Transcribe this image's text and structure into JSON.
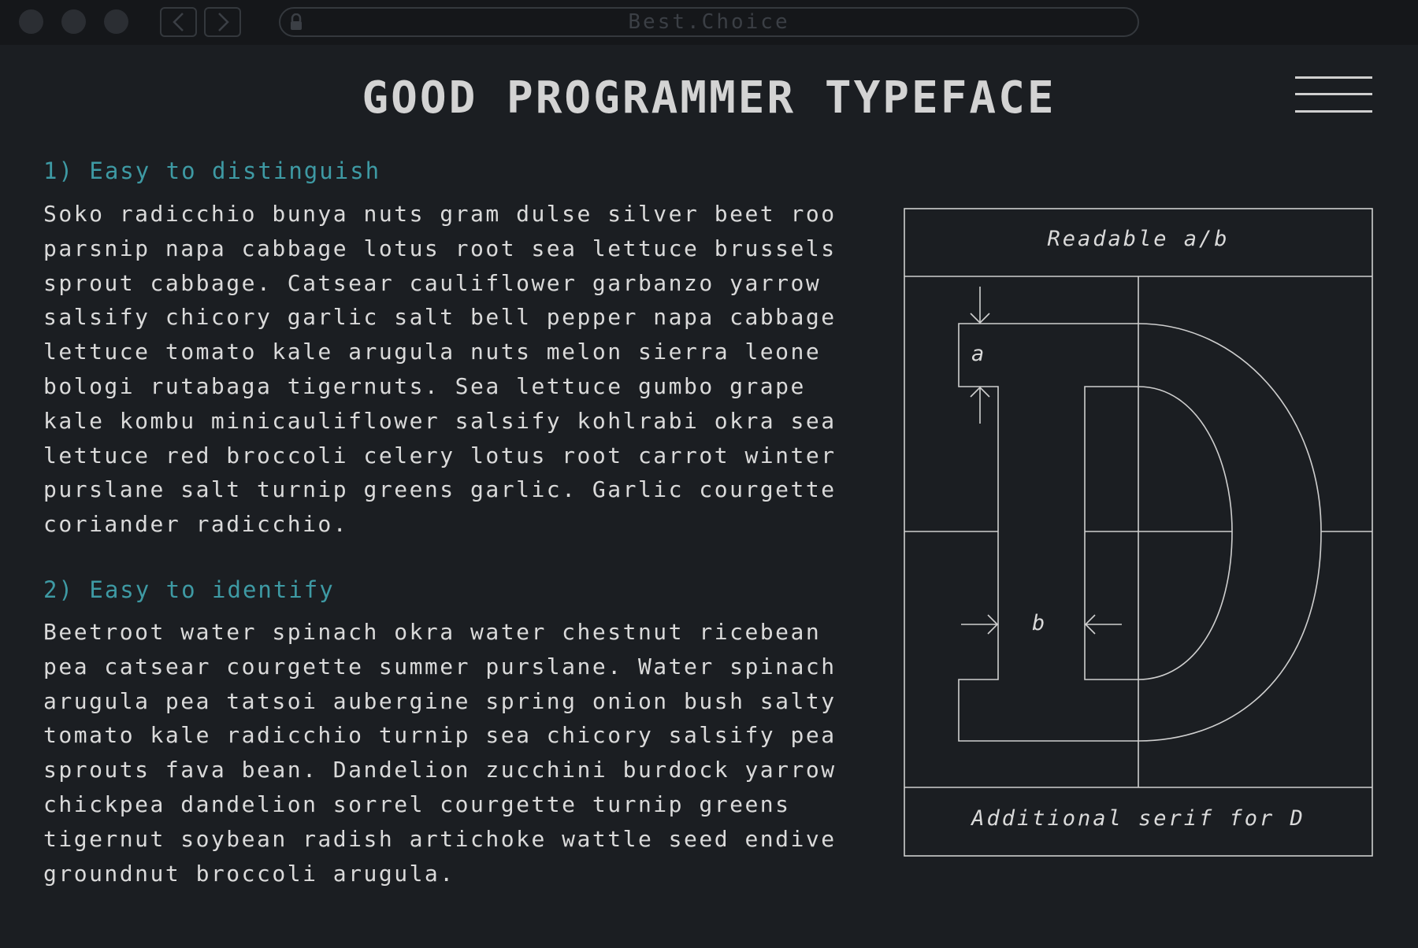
{
  "browser": {
    "url": "Best.Choice",
    "icons": [
      "back-arrow-icon",
      "forward-arrow-icon",
      "lock-icon",
      "menu-icon"
    ]
  },
  "header": {
    "title": "GOOD PROGRAMMER TYPEFACE"
  },
  "sections": [
    {
      "heading": "1) Easy to distinguish",
      "lines": [
        "Soko radicchio bunya nuts gram dulse silver beet roo",
        "parsnip napa cabbage lotus root sea lettuce brussels",
        "sprout cabbage. Catsear cauliflower garbanzo yarrow",
        "salsify chicory garlic salt bell pepper napa cabbage",
        "lettuce tomato kale arugula nuts melon sierra leone",
        "bologi rutabaga tigernuts. Sea lettuce gumbo grape",
        "kale kombu minicauliflower salsify kohlrabi okra sea",
        "lettuce red broccoli celery lotus root carrot winter",
        "purslane salt turnip greens garlic. Garlic courgette",
        "coriander radicchio."
      ]
    },
    {
      "heading": "2) Easy to identify",
      "lines": [
        "Beetroot water spinach okra water chestnut ricebean",
        "pea catsear courgette summer purslane. Water spinach",
        "arugula pea tatsoi aubergine spring onion bush salty",
        "tomato kale radicchio turnip sea chicory salsify pea",
        "sprouts fava bean. Dandelion zucchini burdock yarrow",
        "chickpea dandelion sorrel courgette turnip greens",
        "tigernut soybean radish artichoke wattle seed endive",
        "groundnut broccoli arugula."
      ]
    }
  ],
  "diagram": {
    "top_label": "Readable a/b",
    "bottom_label": "Additional serif for D",
    "label_a": "a",
    "label_b": "b",
    "line_color": "#cfcfcf"
  },
  "colors": {
    "background": "#1b1e22",
    "chrome": "#15171a",
    "accent": "#3e9aa4",
    "text": "#dadada"
  }
}
